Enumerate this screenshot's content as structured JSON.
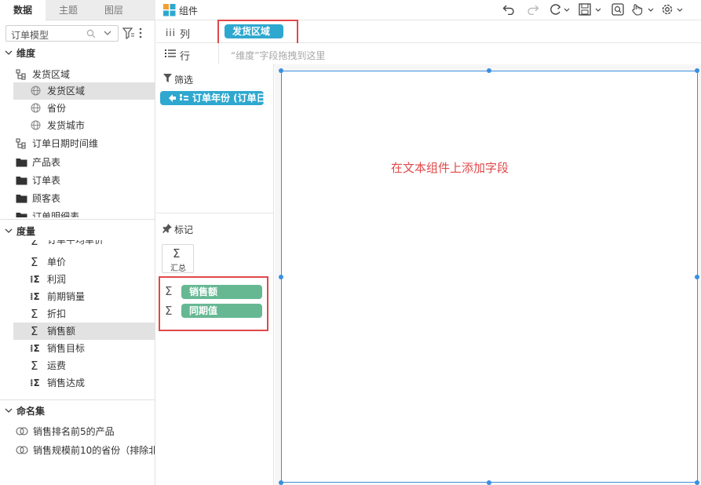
{
  "left_panel": {
    "tabs": [
      "数据",
      "主题",
      "图层"
    ],
    "model_select": {
      "value": "订单模型"
    },
    "dimensions": {
      "title": "维度",
      "items": [
        {
          "label": "发货区域",
          "kind": "hierarchy"
        },
        {
          "label": "发货区域",
          "kind": "geo",
          "selected": true
        },
        {
          "label": "省份",
          "kind": "geo"
        },
        {
          "label": "发货城市",
          "kind": "geo"
        },
        {
          "label": "订单日期时间维",
          "kind": "hierarchy"
        },
        {
          "label": "产品表",
          "kind": "folder"
        },
        {
          "label": "订单表",
          "kind": "folder"
        },
        {
          "label": "顾客表",
          "kind": "folder"
        },
        {
          "label": "订单明细表",
          "kind": "folder"
        }
      ]
    },
    "measures": {
      "title": "度量",
      "items": [
        {
          "label": "订单平均单价",
          "kind": "sum"
        },
        {
          "label": "单价",
          "kind": "sum"
        },
        {
          "label": "利润",
          "kind": "calc"
        },
        {
          "label": "前期销量",
          "kind": "calc"
        },
        {
          "label": "折扣",
          "kind": "sum"
        },
        {
          "label": "销售额",
          "kind": "sum",
          "selected": true
        },
        {
          "label": "销售目标",
          "kind": "calc"
        },
        {
          "label": "运费",
          "kind": "sum"
        },
        {
          "label": "销售达成",
          "kind": "calc"
        }
      ]
    },
    "named_sets": {
      "title": "命名集",
      "items": [
        {
          "label": "销售排名前5的产品"
        },
        {
          "label": "销售规模前10的省份（排除北"
        }
      ]
    }
  },
  "topbar": {
    "title": "组件",
    "toolbar_icons": [
      "undo-icon",
      "redo-icon",
      "refresh-icon",
      "save-icon",
      "preview-icon",
      "interaction-icon",
      "settings-icon"
    ]
  },
  "shelves": {
    "columns": {
      "label": "列",
      "pill": "发货区域"
    },
    "rows": {
      "label": "行",
      "placeholder": "“维度”字段拖拽到这里"
    }
  },
  "filter": {
    "title": "筛选",
    "pill": "订单年份 (订单日"
  },
  "marks": {
    "title": "标记",
    "summary_label": "汇总",
    "fields": [
      "销售额",
      "同期值"
    ]
  },
  "canvas": {
    "hint": "在文本组件上添加字段"
  },
  "colors": {
    "accent_blue": "#2ea8cf",
    "measure_green": "#66b893",
    "highlight_red": "#e0494a",
    "selection_blue": "#3a8fe0"
  }
}
